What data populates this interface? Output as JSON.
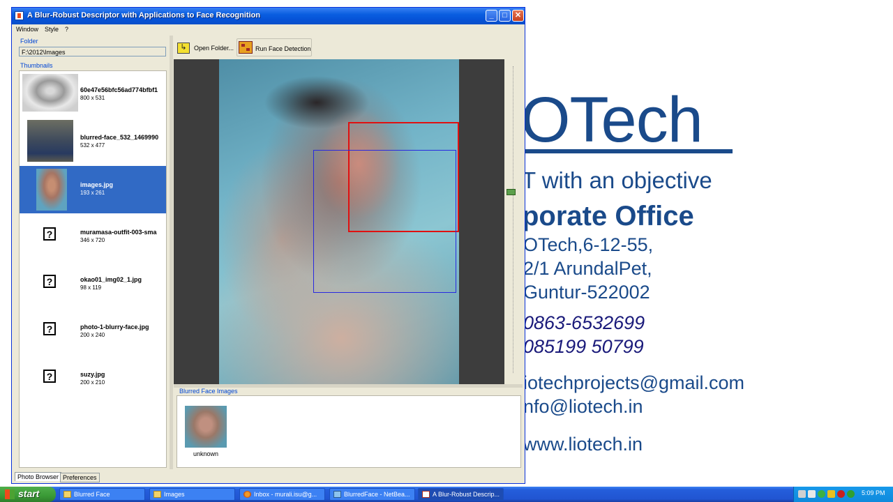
{
  "window": {
    "title": "A Blur-Robust Descriptor with Applications to Face Recognition",
    "minimize_glyph": "_",
    "maximize_glyph": "□",
    "close_glyph": "✕"
  },
  "menu": {
    "items": [
      "Window",
      "Style",
      "?"
    ]
  },
  "folder": {
    "label": "Folder",
    "path": "F:\\2012\\Images"
  },
  "thumbnails": {
    "label": "Thumbnails",
    "items": [
      {
        "name": "60e47e56bfc56ad774bfbf1",
        "size": "800 x 531",
        "has_preview": true,
        "selected": false
      },
      {
        "name": "blurred-face_532_1469990",
        "size": "532 x 477",
        "has_preview": true,
        "selected": false
      },
      {
        "name": "images.jpg",
        "size": "193 x 261",
        "has_preview": true,
        "selected": true
      },
      {
        "name": "muramasa-outfit-003-sma",
        "size": "346 x 720",
        "has_preview": false,
        "selected": false
      },
      {
        "name": "okao01_img02_1.jpg",
        "size": "98 x 119",
        "has_preview": false,
        "selected": false
      },
      {
        "name": "photo-1-blurry-face.jpg",
        "size": "200 x 240",
        "has_preview": false,
        "selected": false
      },
      {
        "name": "suzy.jpg",
        "size": "200 x 210",
        "has_preview": false,
        "selected": false
      }
    ],
    "missing_glyph": "?"
  },
  "tabs": {
    "photo_browser": "Photo Browser",
    "preferences": "Preferences"
  },
  "toolbar": {
    "open_folder": "Open Folder...",
    "run_face_detection": "Run Face Detection"
  },
  "blurred_faces": {
    "label": "Blurred Face Images",
    "items": [
      {
        "label": "unknown"
      }
    ]
  },
  "slide": {
    "logo": "OTech",
    "tagline": "T with an objective",
    "office_title": "porate Office",
    "address_line1": "OTech,6-12-55,",
    "address_line2": "2/1 ArundalPet,",
    "address_line3": "Guntur-522002",
    "phone1": "0863-6532699",
    "phone2": "085199 50799",
    "email1": "iotechprojects@gmail.com",
    "email2": "nfo@liotech.in",
    "website": "www.liotech.in",
    "accent_color": "#1a4a8a"
  },
  "taskbar": {
    "start_label": "start",
    "tasks": [
      {
        "label": "Blurred Face",
        "icon": "folder-icon",
        "active": false
      },
      {
        "label": "Images",
        "icon": "folder-icon",
        "active": false
      },
      {
        "label": "Inbox - murali.isu@g...",
        "icon": "firefox-icon",
        "active": false
      },
      {
        "label": "BlurredFace - NetBea...",
        "icon": "netbeans-icon",
        "active": false
      },
      {
        "label": "A Blur-Robust Descrip...",
        "icon": "java-icon",
        "active": true
      }
    ],
    "clock": "5:09 PM"
  }
}
